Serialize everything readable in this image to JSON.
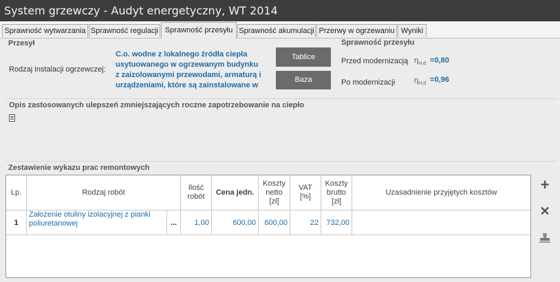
{
  "window": {
    "title": "System grzewczy - Audyt energetyczny, WT 2014"
  },
  "tabs": [
    {
      "label": "Sprawność wytwarzania"
    },
    {
      "label": "Sprawność regulacji"
    },
    {
      "label": "Sprawność przesyłu"
    },
    {
      "label": "Sprawność akumulacji"
    },
    {
      "label": "Przerwy w ogrzewaniu"
    },
    {
      "label": "Wyniki"
    }
  ],
  "przesyl": {
    "title": "Przesył",
    "installation_label": "Rodzaj instalacji ogrzewczej:",
    "installation_lines": [
      "C.o. wodne z lokalnego źródła ciepła",
      "usytuowanego w ogrzewanym budynku",
      "z zaizolowanymi przewodami, armaturą i",
      "urządzeniami, które są zainstalowane w"
    ],
    "btn_tablice": "Tablice",
    "btn_baza": "Baza"
  },
  "efficiency": {
    "title": "Sprawność przesyłu",
    "before_label": "Przed modernizacją",
    "after_label": "Po modernizacji",
    "symbol": "η",
    "subscript": "H,d",
    "eq": "=",
    "before_value": "0,80",
    "after_value": "0,96"
  },
  "opis": {
    "title": "Opis zastosowanych ulepszeń zmniejszających roczne zapotrzebowanie na ciepło"
  },
  "works": {
    "title": "Zestawienie wykazu prac remontowych",
    "headers": {
      "lp": "Lp.",
      "rodzaj": "Rodzaj robót",
      "ilosc_1": "Ilość",
      "ilosc_2": "robót",
      "cena": "Cena jedn.",
      "netto_1": "Koszty",
      "netto_2": "netto",
      "netto_3": "[zł]",
      "vat_1": "VAT",
      "vat_2": "[%]",
      "brutto_1": "Koszty",
      "brutto_2": "brutto",
      "brutto_3": "[zł]",
      "uzasadnienie": "Uzasadnienie przyjętych kosztów"
    },
    "rows": [
      {
        "lp": "1",
        "rodzaj_1": "Założenie otuliny izolacyjnej z pianki",
        "rodzaj_2": "poliuretanowej",
        "more": "...",
        "ilosc": "1,00",
        "cena": "600,00",
        "netto": "600,00",
        "vat": "22",
        "brutto": "732,00",
        "uzasadnienie": ""
      }
    ]
  }
}
